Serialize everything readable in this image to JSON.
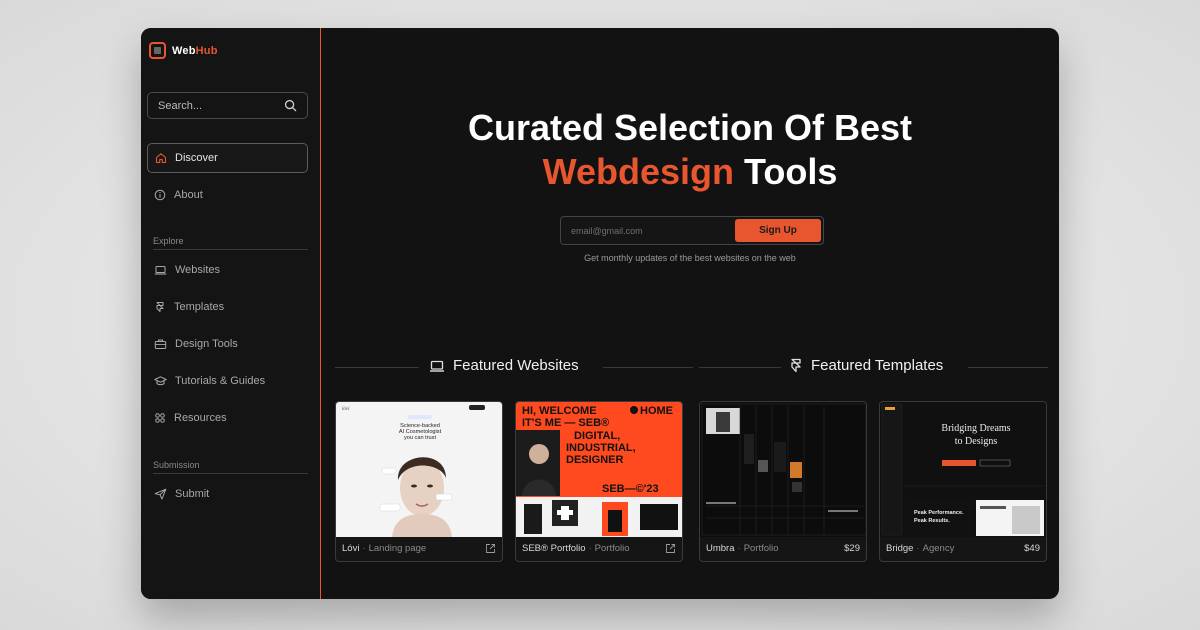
{
  "brand": {
    "name_part1": "Web",
    "name_part2": "Hub"
  },
  "search": {
    "placeholder": "Search..."
  },
  "nav": {
    "discover": "Discover",
    "about": "About",
    "explore_label": "Explore",
    "websites": "Websites",
    "templates": "Templates",
    "design_tools": "Design Tools",
    "tutorials": "Tutorials & Guides",
    "resources": "Resources",
    "submission_label": "Submission",
    "submit": "Submit"
  },
  "hero": {
    "line1": "Curated Selection Of Best",
    "accent": "Webdesign",
    "line2_rest": " Tools",
    "email_placeholder": "email@gmail.com",
    "signup_label": "Sign Up",
    "subtitle": "Get monthly updates of the best websites on the web"
  },
  "featured": {
    "websites_title": "Featured Websites",
    "templates_title": "Featured Templates"
  },
  "cards": [
    {
      "name": "Lóvi",
      "category": "Landing page",
      "thumb": {
        "l1": "Science-backed",
        "l2": "AI Cosmetologist",
        "l3": "you can trust"
      }
    },
    {
      "name": "SEB® Portfolio",
      "category": "Portfolio",
      "thumb": {
        "l1": "HI, WELCOME",
        "l1b": "HOME",
        "l2": "IT'S ME — SEB®",
        "l3": "DIGITAL,",
        "l4": "INDUSTRIAL,",
        "l5": "DESIGNER",
        "l6": "SEB—©'23"
      }
    },
    {
      "name": "Umbra",
      "category": "Portfolio",
      "price": "$29"
    },
    {
      "name": "Bridge",
      "category": "Agency",
      "price": "$49",
      "thumb": {
        "l1": "Bridging Dreams",
        "l2": "to Designs",
        "l3": "Peak Performance.",
        "l4": "Peak Results."
      }
    }
  ],
  "colors": {
    "accent": "#e8562f",
    "background": "#121212"
  }
}
